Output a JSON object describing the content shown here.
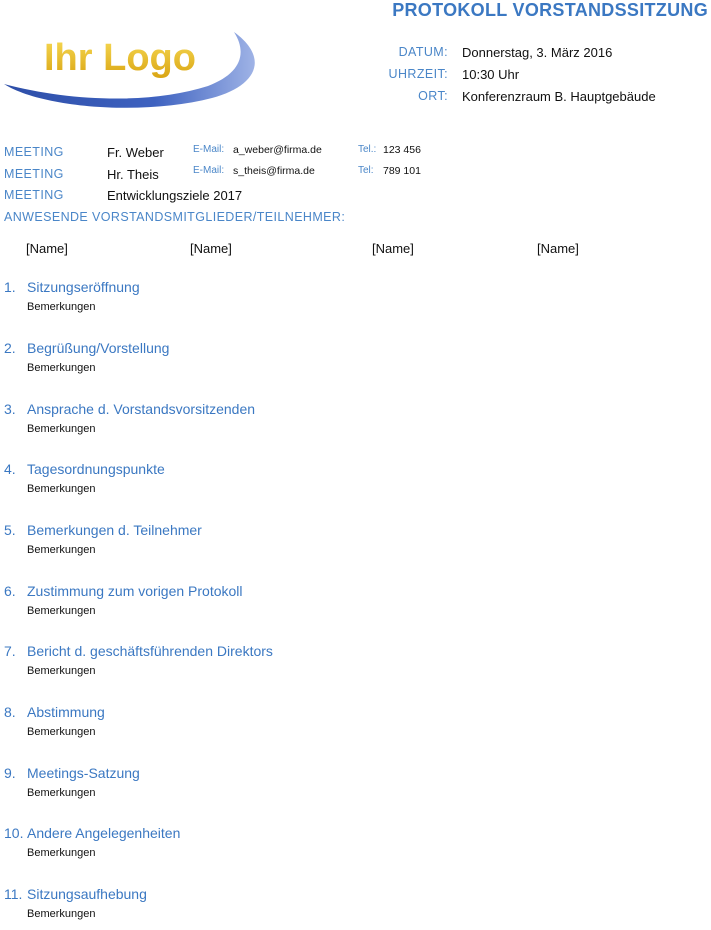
{
  "document": {
    "title": "PROTOKOLL VORSTANDSSITZUNG",
    "logo_text": "Ihr Logo"
  },
  "header": {
    "date_label": "DATUM:",
    "date_value": "Donnerstag, 3. März 2016",
    "time_label": "UHRZEIT:",
    "time_value": "10:30 Uhr",
    "place_label": "ORT:",
    "place_value": "Konferenzraum B. Hauptgebäude"
  },
  "meeting": {
    "rows": [
      {
        "label": "MEETING",
        "name": "Fr. Weber",
        "email_label": "E-Mail:",
        "email": "a_weber@firma.de",
        "tel_label": "Tel.:",
        "tel": "123 456"
      },
      {
        "label": "MEETING",
        "name": "Hr. Theis",
        "email_label": "E-Mail:",
        "email": "s_theis@firma.de",
        "tel_label": "Tel:",
        "tel": "789 101"
      }
    ],
    "topic_label": "MEETING",
    "topic_value": "Entwicklungsziele 2017",
    "attendees_label": "ANWESENDE VORSTANDSMITGLIEDER/TEILNEHMER:",
    "attendees": [
      "[Name]",
      "[Name]",
      "[Name]",
      "[Name]"
    ]
  },
  "agenda": [
    {
      "num": "1.",
      "title": "Sitzungseröffnung",
      "remark": "Bemerkungen"
    },
    {
      "num": "2.",
      "title": "Begrüßung/Vorstellung",
      "remark": "Bemerkungen"
    },
    {
      "num": "3.",
      "title": "Ansprache d. Vorstandsvorsitzenden",
      "remark": "Bemerkungen"
    },
    {
      "num": "4.",
      "title": "Tagesordnungspunkte",
      "remark": "Bemerkungen"
    },
    {
      "num": "5.",
      "title": "Bemerkungen d. Teilnehmer",
      "remark": "Bemerkungen"
    },
    {
      "num": "6.",
      "title": "Zustimmung zum vorigen Protokoll",
      "remark": "Bemerkungen"
    },
    {
      "num": "7.",
      "title": "Bericht d. geschäftsführenden Direktors",
      "remark": "Bemerkungen"
    },
    {
      "num": "8.",
      "title": "Abstimmung",
      "remark": "Bemerkungen"
    },
    {
      "num": "9.",
      "title": "Meetings-Satzung",
      "remark": "Bemerkungen"
    },
    {
      "num": "10.",
      "title": "Andere Angelegenheiten",
      "remark": "Bemerkungen"
    },
    {
      "num": "11.",
      "title": "Sitzungsaufhebung",
      "remark": "Bemerkungen"
    }
  ]
}
